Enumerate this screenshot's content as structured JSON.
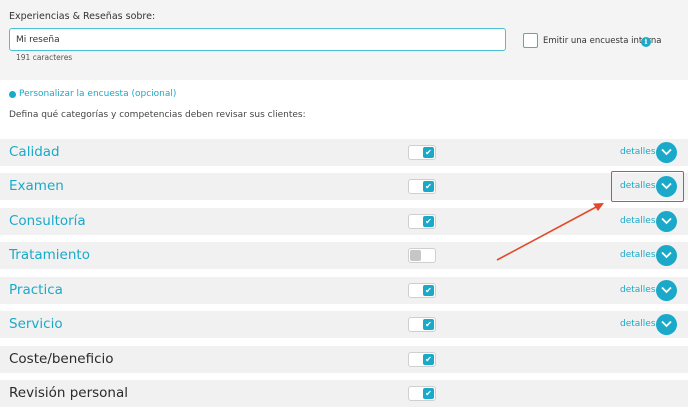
{
  "survey": {
    "section_label": "Experiencias & Reseñas sobre:",
    "review_value": "Mi reseña",
    "char_count": "191 caracteres",
    "internal_label": "Emitir una encuesta interna",
    "info_icon_glyph": "i",
    "personalize_link": "Personalizar la encuesta (opcional)",
    "define_text": "Defina qué categorías y competencias deben revisar sus clientes:"
  },
  "colors": {
    "accent": "#1ba9c9",
    "row_bg": "#f1f1f1",
    "highlight": "#e24a2b"
  },
  "categories": [
    {
      "label": "Calidad",
      "enabled": true,
      "details": "detalles"
    },
    {
      "label": "Examen",
      "enabled": true,
      "details": "detalles",
      "highlighted": true
    },
    {
      "label": "Consultoría",
      "enabled": true,
      "details": "detalles"
    },
    {
      "label": "Tratamiento",
      "enabled": false,
      "details": "detalles"
    },
    {
      "label": "Practica",
      "enabled": true,
      "details": "detalles"
    },
    {
      "label": "Servicio",
      "enabled": true,
      "details": "detalles"
    },
    {
      "label": "Coste/beneficio",
      "enabled": true
    },
    {
      "label": "Revisión personal",
      "enabled": true
    }
  ],
  "check_glyph": "✔"
}
